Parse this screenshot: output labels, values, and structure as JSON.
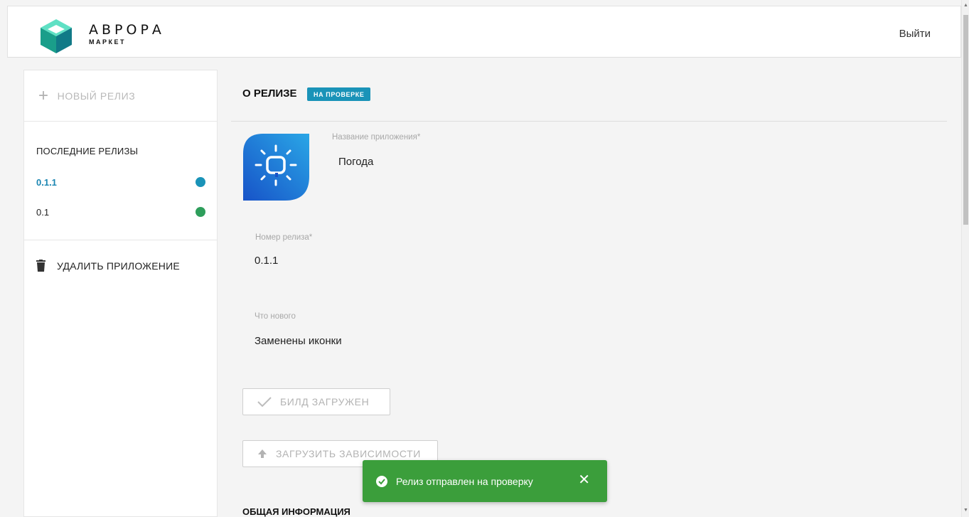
{
  "header": {
    "brand_name": "АВРОРА",
    "brand_sub": "МАРКЕТ",
    "logout_label": "Выйти"
  },
  "sidebar": {
    "new_release_label": "НОВЫЙ РЕЛИЗ",
    "recent_title": "ПОСЛЕДНИЕ РЕЛИЗЫ",
    "releases": [
      {
        "label": "0.1.1",
        "status_color": "#1a93b8"
      },
      {
        "label": "0.1",
        "status_color": "#2e9e5b"
      }
    ],
    "delete_app_label": "УДАЛИТЬ ПРИЛОЖЕНИЕ"
  },
  "main": {
    "section_title": "О РЕЛИЗЕ",
    "status_badge": "НА ПРОВЕРКЕ",
    "app_name_label": "Название приложения*",
    "app_name_value": "Погода",
    "release_number_label": "Номер релиза*",
    "release_number_value": "0.1.1",
    "whats_new_label": "Что нового",
    "whats_new_value": "Заменены иконки",
    "build_uploaded_label": "БИЛД ЗАГРУЖЕН",
    "upload_deps_label": "ЗАГРУЗИТЬ ЗАВИСИМОСТИ",
    "general_info_title": "ОБЩАЯ ИНФОРМАЦИЯ"
  },
  "toast": {
    "message": "Релиз отправлен на проверку",
    "close_symbol": "✕"
  },
  "colors": {
    "accent": "#1a93b8",
    "success": "#3b9e3b",
    "release_active": "#1b86b2"
  }
}
